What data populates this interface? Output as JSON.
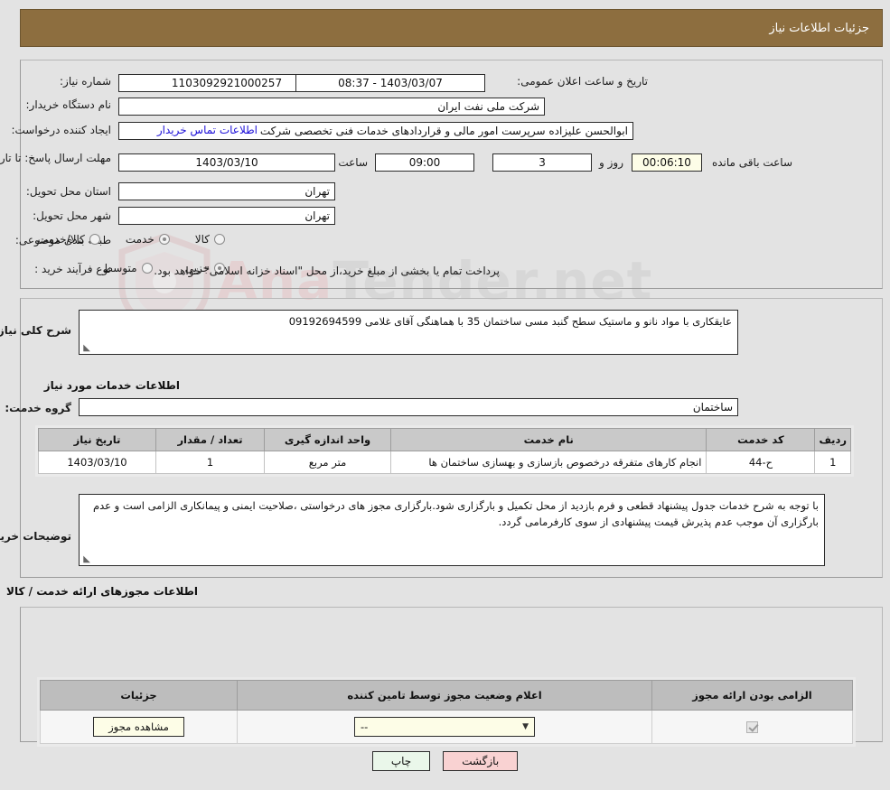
{
  "header": {
    "title": "جزئیات اطلاعات نیاز"
  },
  "form": {
    "need_number_label": "شماره نیاز:",
    "need_number_value": "1103092921000257",
    "buyer_org_label": "نام دستگاه خریدار:",
    "buyer_org_value": "شرکت ملی نفت ایران",
    "requester_label": "ایجاد کننده درخواست:",
    "requester_value": "ابوالحسن علیزاده سرپرست امور مالی و قراردادهای خدمات فنی تخصصی شرکت",
    "contact_link": "اطلاعات تماس خریدار",
    "deadline_label": "مهلت ارسال پاسخ: تا تاریخ:",
    "deadline_date": "1403/03/10",
    "time_label": "ساعت",
    "deadline_time": "09:00",
    "days_value": "3",
    "days_label": "روز و",
    "remaining_value": "00:06:10",
    "remaining_label": "ساعت باقی مانده",
    "announce_label": "تاریخ و ساعت اعلان عمومی:",
    "announce_value": "1403/03/07 - 08:37",
    "province_label": "استان محل تحویل:",
    "province_value": "تهران",
    "city_label": "شهر محل تحویل:",
    "city_value": "تهران",
    "classification_label": "طبقه بندی موضوعی:",
    "classification_options": [
      {
        "label": "کالا",
        "selected": false
      },
      {
        "label": "خدمت",
        "selected": true
      },
      {
        "label": "کالا/خدمت",
        "selected": false
      }
    ],
    "purchase_type_label": "نوع فرآیند خرید :",
    "purchase_type_options": [
      {
        "label": "جزیی",
        "selected": true
      },
      {
        "label": "متوسط",
        "selected": false
      }
    ],
    "payment_note": "پرداخت تمام یا بخشی از مبلغ خرید،از محل \"اسناد خزانه اسلامی\" خواهد بود."
  },
  "description": {
    "need_summary_label": "شرح کلی نیاز:",
    "need_summary_value": "عایقکاری با مواد نانو و ماستیک سطح گنبد مسی ساختمان 35  با هماهنگی آقای غلامی   09192694599",
    "services_section_title": "اطلاعات خدمات مورد نیاز",
    "service_group_label": "گروه خدمت:",
    "service_group_value": "ساختمان",
    "buyer_notes_label": "توضیحات خریدار:",
    "buyer_notes_value": "با توجه به شرح خدمات جدول پیشنهاد قطعی و فرم بازدید از محل تکمیل و بارگزاری شود.بارگزاری مجوز های درخواستی ،صلاحیت ایمنی و پیمانکاری الزامی است و عدم بارگزاری آن موجب عدم پذیرش قیمت پیشنهادی  از سوی کارفرمامی گردد."
  },
  "service_table": {
    "columns": [
      "ردیف",
      "کد خدمت",
      "نام خدمت",
      "واحد اندازه گیری",
      "تعداد / مقدار",
      "تاریخ نیاز"
    ],
    "rows": [
      {
        "row": "1",
        "code": "ح-44",
        "name": "انجام کارهای متفرقه درخصوص بازسازی و بهسازی ساختمان ها",
        "unit": "متر مربع",
        "qty": "1",
        "date": "1403/03/10"
      }
    ]
  },
  "permits": {
    "section_title": "اطلاعات مجوزهای ارائه خدمت / کالا",
    "columns": [
      "الزامی بودن ارائه مجوز",
      "اعلام وضعیت مجوز توسط تامین کننده",
      "جزئیات"
    ],
    "rows": [
      {
        "required": true,
        "status_value": "--",
        "details_button": "مشاهده مجوز"
      }
    ]
  },
  "footer": {
    "print_label": "چاپ",
    "back_label": "بازگشت"
  },
  "watermark": {
    "text_left": "Ana",
    "text_right": "Tender.net"
  },
  "colors": {
    "header_brown": "#8d6e3f",
    "link_blue": "#1d10d8",
    "page_bg": "#e3e3e3",
    "field_cream": "#fdfde7",
    "print_green": "#eaf7ea",
    "back_pink": "#f9d2d2"
  }
}
